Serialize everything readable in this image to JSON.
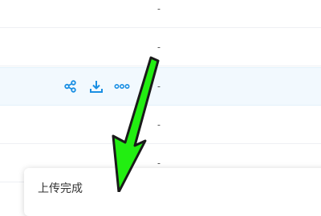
{
  "file_list": {
    "rows": [
      {
        "size": "-"
      },
      {
        "size": "-"
      },
      {
        "size": "-",
        "hovered": true,
        "actions": [
          {
            "icon": "share-icon"
          },
          {
            "icon": "download-icon"
          },
          {
            "icon": "more-icon"
          }
        ]
      },
      {
        "size": "-"
      },
      {
        "size": "-"
      }
    ]
  },
  "toast": {
    "title": "上传完成"
  },
  "annotation": {
    "arrow_color": "#22ee11",
    "arrow_outline": "#1a1a1a"
  },
  "colors": {
    "accent": "#1a8fe3",
    "hover_row": "#f2f9fe"
  }
}
